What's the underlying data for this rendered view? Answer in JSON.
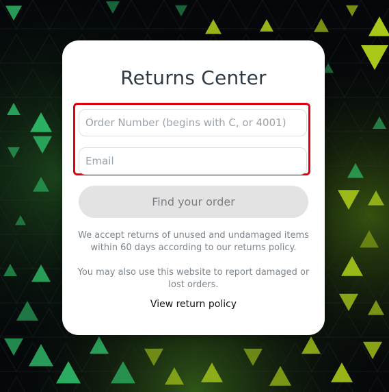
{
  "title": "Returns Center",
  "form": {
    "order_placeholder": "Order Number (begins with C, or 4001)",
    "order_value": "",
    "email_placeholder": "Email",
    "email_value": "",
    "submit_label": "Find your order",
    "highlight_color": "#e00010"
  },
  "info": {
    "line1a": "We accept returns of unused and undamaged items",
    "line1b": "within 60 days according to our returns policy.",
    "line2a": "You may also use this website to report damaged or",
    "line2b": "lost orders."
  },
  "policy_link": "View return policy",
  "colors": {
    "background": "#05070a",
    "triangle_green": "#2fbf6a",
    "triangle_lime": "#a8c81a",
    "button_bg": "#e3e3e3"
  }
}
